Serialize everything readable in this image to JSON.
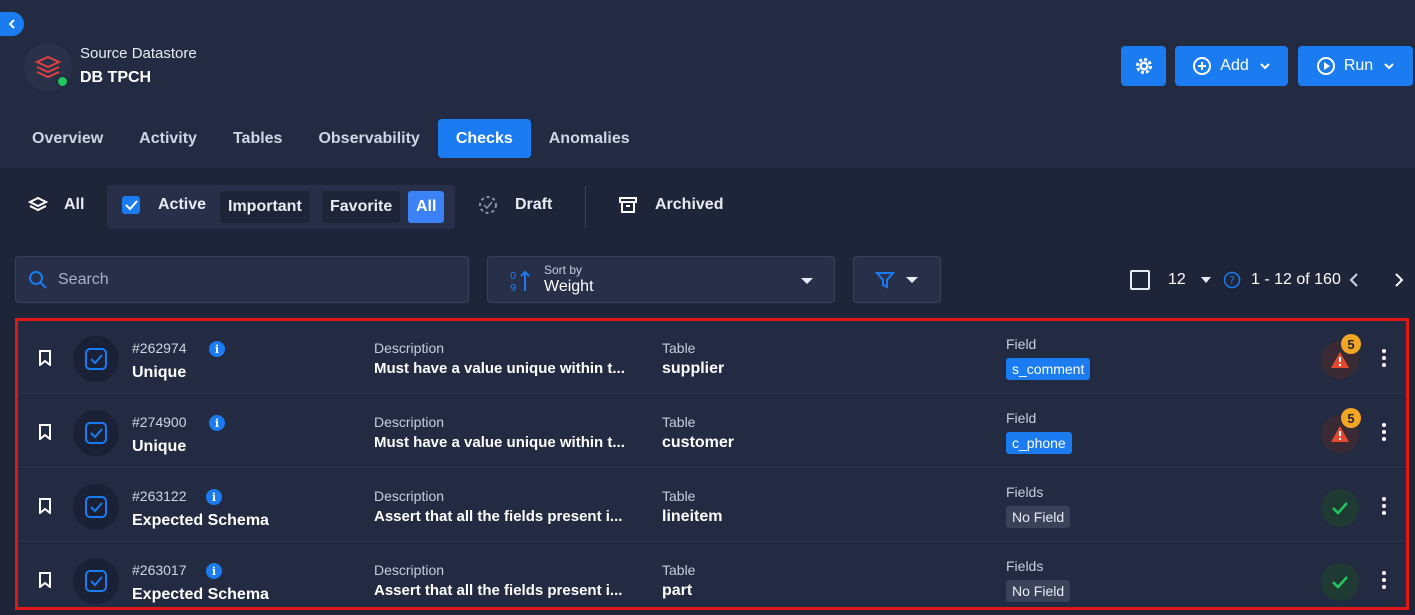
{
  "header": {
    "datastore_label": "Source Datastore",
    "datastore_name": "DB TPCH",
    "add_label": "Add",
    "run_label": "Run"
  },
  "tabs": [
    "Overview",
    "Activity",
    "Tables",
    "Observability",
    "Checks",
    "Anomalies"
  ],
  "active_tab": "Checks",
  "filters": {
    "all": "All",
    "active": "Active",
    "important": "Important",
    "favorite": "Favorite",
    "all_chip": "All",
    "draft": "Draft",
    "archived": "Archived"
  },
  "search": {
    "placeholder": "Search"
  },
  "sort": {
    "label": "Sort by",
    "value": "Weight"
  },
  "pagination": {
    "page_size": "12",
    "range": "1 - 12 of 160"
  },
  "checks": [
    {
      "id": "#262974",
      "type": "Unique",
      "description_label": "Description",
      "description": "Must have a value unique within t...",
      "table_label": "Table",
      "table": "supplier",
      "field_label": "Field",
      "field": "s_comment",
      "status": "warning",
      "anomaly_count": "5"
    },
    {
      "id": "#274900",
      "type": "Unique",
      "description_label": "Description",
      "description": "Must have a value unique within t...",
      "table_label": "Table",
      "table": "customer",
      "field_label": "Field",
      "field": "c_phone",
      "status": "warning",
      "anomaly_count": "5"
    },
    {
      "id": "#263122",
      "type": "Expected Schema",
      "description_label": "Description",
      "description": "Assert that all the fields present i...",
      "table_label": "Table",
      "table": "lineitem",
      "field_label": "Fields",
      "field": "No Field",
      "status": "ok",
      "anomaly_count": ""
    },
    {
      "id": "#263017",
      "type": "Expected Schema",
      "description_label": "Description",
      "description": "Assert that all the fields present i...",
      "table_label": "Table",
      "table": "part",
      "field_label": "Fields",
      "field": "No Field",
      "status": "ok",
      "anomaly_count": ""
    }
  ],
  "colors": {
    "accent": "#1a7cf0",
    "background": "#1e2538",
    "highlight_border": "#e01515",
    "warning": "#f5a524",
    "success": "#22c55e"
  }
}
